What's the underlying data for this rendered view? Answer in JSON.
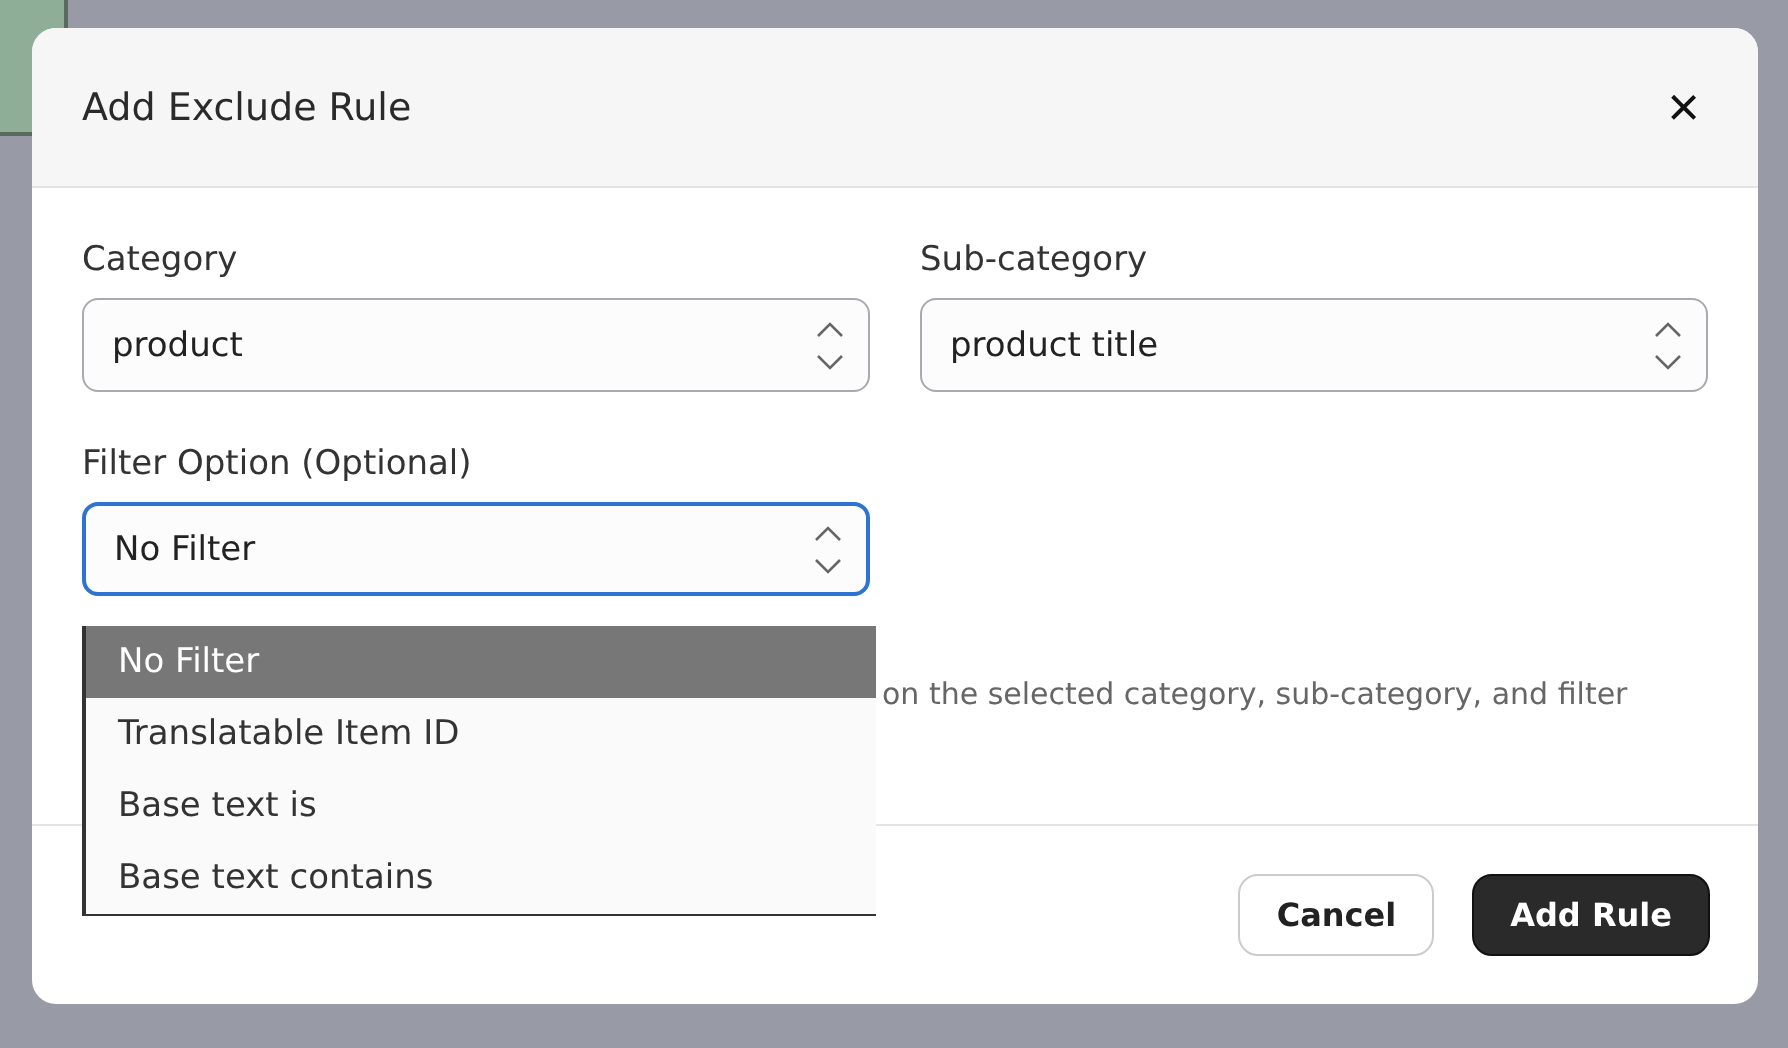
{
  "dialog": {
    "title": "Add Exclude Rule",
    "close": "×"
  },
  "fields": [
    {
      "label": "Category",
      "value": "product",
      "focused": false
    },
    {
      "label": "Sub-category",
      "value": "product title",
      "focused": false
    }
  ],
  "filter": {
    "label": "Filter Option (Optional)",
    "value": "No Filter",
    "focused": true,
    "options": [
      {
        "label": "No Filter",
        "selected": true
      },
      {
        "label": "Translatable Item ID",
        "selected": false
      },
      {
        "label": "Base text is",
        "selected": false
      },
      {
        "label": "Base text contains",
        "selected": false
      }
    ]
  },
  "help": "on the selected category, sub-category, and filter",
  "buttons": [
    {
      "label": "Cancel",
      "kind": "secondary"
    },
    {
      "label": "Add Rule",
      "kind": "primary"
    }
  ]
}
